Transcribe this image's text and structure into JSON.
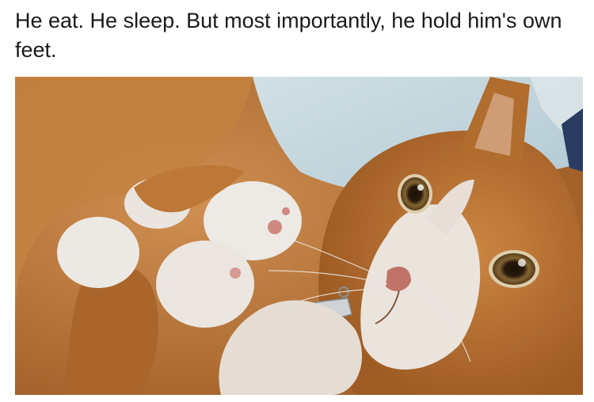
{
  "meme": {
    "caption": "He eat. He sleep. But most importantly, he hold him's own feet."
  },
  "photo": {
    "subject_icon": "cat-photo",
    "colors": {
      "fur_orange": "#c9803d",
      "fur_white": "#f3ede6",
      "blanket_blue": "#cfe3ea",
      "paw_pink": "#d98f86",
      "eye_amber": "#7a5a2c",
      "nose_pink": "#c9786e"
    }
  }
}
